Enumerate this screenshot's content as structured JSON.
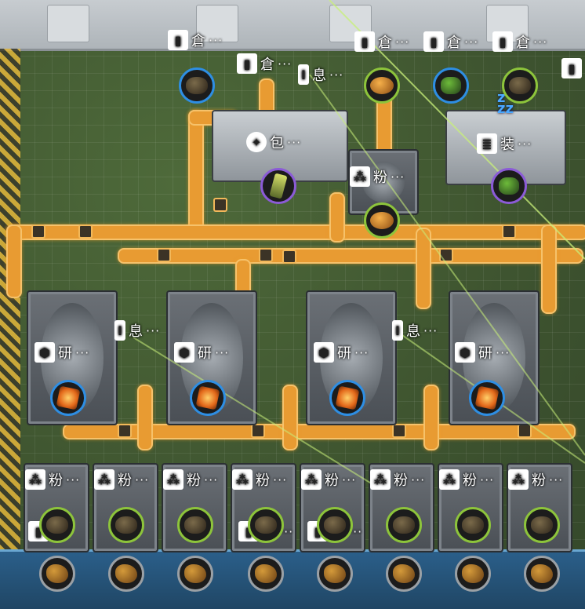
{
  "labels": {
    "storage": "倉",
    "rest": "息",
    "pack": "包",
    "powder": "粉",
    "equip": "装",
    "research": "研",
    "ellipsis": "···"
  },
  "colors": {
    "belt": "#e89b32",
    "bubble_blue": "#2e8ee3",
    "bubble_green": "#8dc43b",
    "bubble_purple": "#8b5bd6",
    "beam": "#c9f07a"
  },
  "icons": {
    "storage": "storage-icon",
    "rest": "rest-icon",
    "pack": "pack-icon",
    "powder": "powder-icon",
    "equip": "equip-icon",
    "research": "research-icon",
    "sleep": "sleep-zzz-icon"
  }
}
